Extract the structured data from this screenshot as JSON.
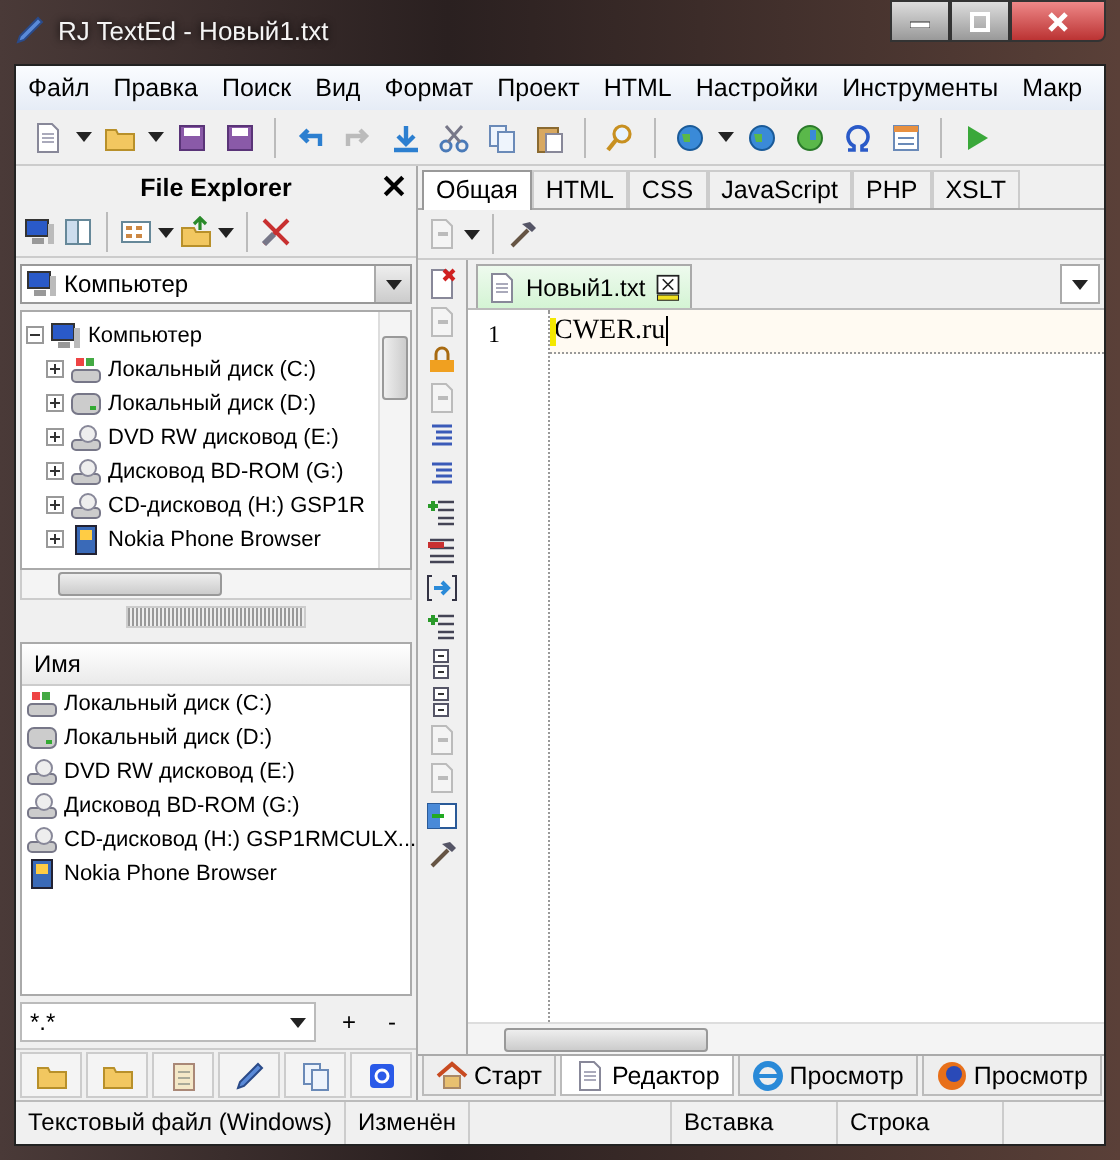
{
  "window": {
    "title": "RJ TextEd - Новый1.txt"
  },
  "menu": [
    "Файл",
    "Правка",
    "Поиск",
    "Вид",
    "Формат",
    "Проект",
    "HTML",
    "Настройки",
    "Инструменты",
    "Макр"
  ],
  "file_explorer": {
    "title": "File Explorer",
    "location": "Компьютер",
    "tree": [
      {
        "label": "Компьютер",
        "expanded": true,
        "children": [
          {
            "label": "Локальный диск (C:)",
            "expanded": false
          },
          {
            "label": "Локальный диск (D:)",
            "expanded": false
          },
          {
            "label": "DVD RW дисковод (E:)",
            "expanded": false
          },
          {
            "label": "Дисковод BD-ROM (G:)",
            "expanded": false
          },
          {
            "label": "CD-дисковод (H:) GSP1R",
            "expanded": false
          },
          {
            "label": "Nokia Phone Browser",
            "expanded": false
          }
        ]
      }
    ],
    "list_header": "Имя",
    "files": [
      "Локальный диск (C:)",
      "Локальный диск (D:)",
      "DVD RW дисковод (E:)",
      "Дисковод BD-ROM (G:)",
      "CD-дисковод (H:) GSP1RMCULX...",
      "Nokia Phone Browser"
    ],
    "filter": "*.*",
    "filter_buttons": [
      "+",
      "-"
    ]
  },
  "editor_tabs": [
    {
      "label": "Общая",
      "selected": true
    },
    {
      "label": "HTML",
      "selected": false
    },
    {
      "label": "CSS",
      "selected": false
    },
    {
      "label": "JavaScript",
      "selected": false
    },
    {
      "label": "PHP",
      "selected": false
    },
    {
      "label": "XSLT",
      "selected": false
    }
  ],
  "document_tab": {
    "label": "Новый1.txt"
  },
  "lines": [
    {
      "number": "1",
      "text": "CWER.ru"
    }
  ],
  "view_tabs": [
    {
      "label": "Старт",
      "selected": false
    },
    {
      "label": "Редактор",
      "selected": true
    },
    {
      "label": "Просмотр",
      "selected": false
    },
    {
      "label": "Просмотр",
      "selected": false
    }
  ],
  "status_bar": [
    "Текстовый файл (Windows)",
    "Изменён",
    "Вставка",
    "Строка"
  ]
}
